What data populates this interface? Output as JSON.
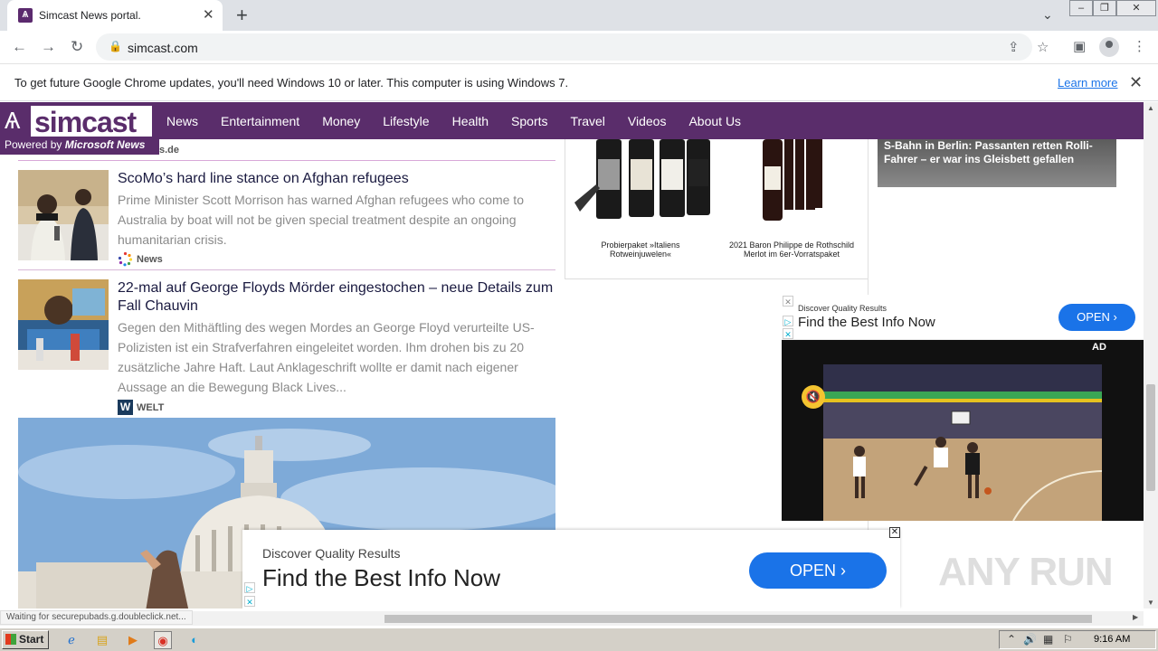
{
  "browser": {
    "tab_title": "Simcast News portal.",
    "url": "simcast.com",
    "infobar_text": "To get future Google Chrome updates, you'll need Windows 10 or later. This computer is using Windows 7.",
    "infobar_link": "Learn more",
    "status_text": "Waiting for securepubads.g.doubleclick.net..."
  },
  "site": {
    "logo_text": "simcast",
    "powered_by": "Powered by",
    "powered_brand": "Microsoft News",
    "nav": [
      "News",
      "Entertainment",
      "Money",
      "Lifestyle",
      "Health",
      "Sports",
      "Travel",
      "Videos",
      "About Us"
    ],
    "prev_source": "s.de"
  },
  "articles": [
    {
      "title": "ScoMo’s hard line stance on Afghan refugees",
      "description": "Prime Minister Scott Morrison has warned Afghan refugees who come to Australia by boat will not be given special treatment despite an ongoing humanitarian crisis.",
      "source": "News"
    },
    {
      "title": "22-mal auf George Floyds Mörder eingestochen – neue Details zum Fall Chauvin",
      "description": "Gegen den Mithäftling des wegen Mordes an George Floyd verurteilte US-Polizisten ist ein Strafverfahren eingeleitet worden. Ihm drohen bis zu 20 zusätzliche Jahre Haft. Laut Anklageschrift wollte er damit nach eigener Aussage an die Bewegung Black Lives...",
      "source": "WELT",
      "source_icon_letter": "W"
    }
  ],
  "wine_ad": {
    "items": [
      "Probierpaket »Italiens Rotweinjuwelen«",
      "2021 Baron Philippe de Rothschild Merlot im 6er-Vorratspaket"
    ]
  },
  "rail_news": {
    "headline": "S-Bahn in Berlin: Passanten retten Rolli-Fahrer – er war ins Gleisbett gefallen"
  },
  "video_ad": {
    "small": "Discover Quality Results",
    "big": "Find the Best Info Now",
    "button": "OPEN",
    "ad_label": "AD"
  },
  "banner_ad": {
    "small": "Discover Quality Results",
    "big": "Find the Best Info Now",
    "button": "OPEN"
  },
  "watermark": "ANY RUN",
  "taskbar": {
    "start": "Start",
    "clock": "9:16 AM"
  },
  "colors": {
    "brand": "#5a2d6b",
    "cta": "#1a73e8"
  }
}
